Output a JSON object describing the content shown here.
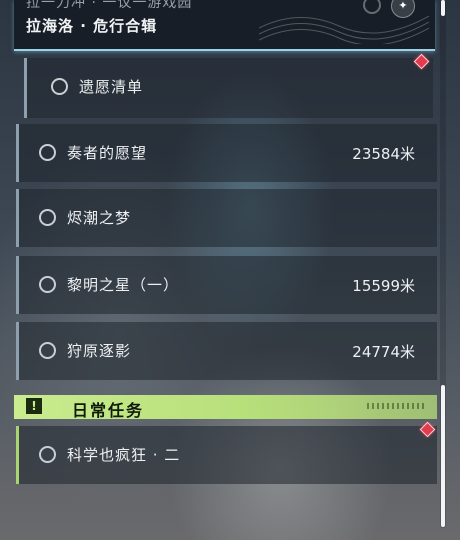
{
  "header": {
    "cut_text": "拉一力冲 · 一议一游戏园",
    "title": "拉海洛 · 危行合辑",
    "star_icon": "✦"
  },
  "sub_quest": {
    "label": "遗愿清单"
  },
  "quests": [
    {
      "label": "奏者的愿望",
      "distance": "23584米"
    },
    {
      "label": "烬潮之梦",
      "distance": ""
    },
    {
      "label": "黎明之星（一）",
      "distance": "15599米"
    },
    {
      "label": "狩原逐影",
      "distance": "24774米"
    }
  ],
  "daily_section": {
    "title": "日常任务",
    "icon": "!"
  },
  "daily_quests": [
    {
      "label": "科学也疯狂 · 二"
    }
  ],
  "colors": {
    "accent_green": "#c9ec8e",
    "marker_red": "#e23d4f",
    "header_glow": "#9fd2e6"
  }
}
